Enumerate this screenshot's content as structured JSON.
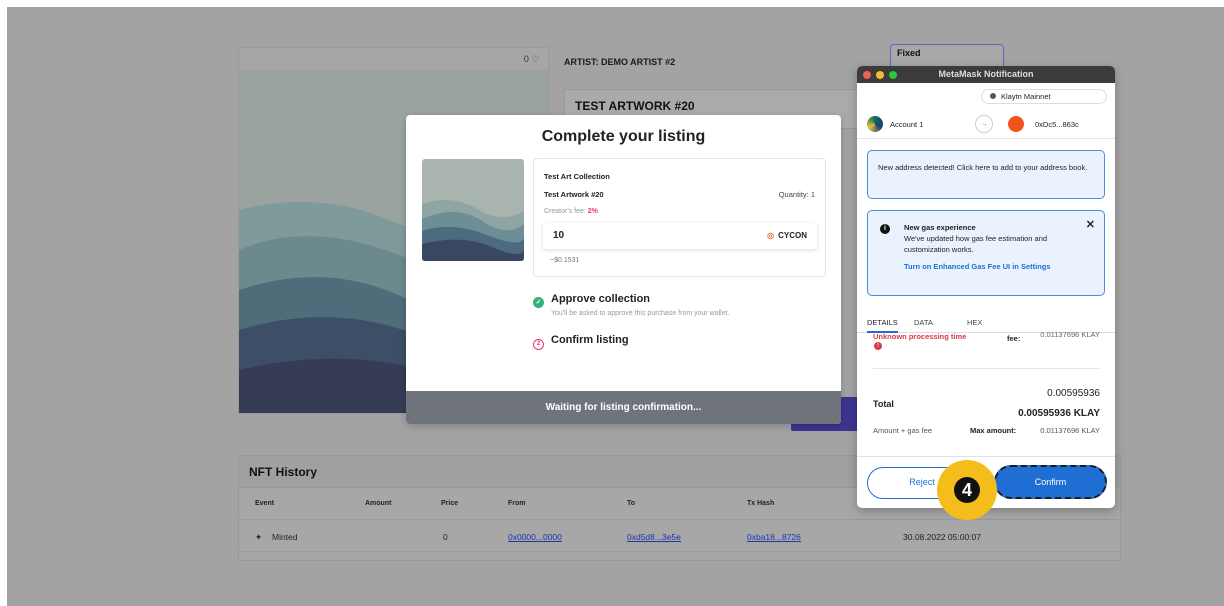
{
  "background": {
    "likes": "0",
    "artist_label": "ARTIST: DEMO ARTIST #2",
    "artwork_title": "TEST ARTWORK #20",
    "fixed_tab": "Fixed",
    "history": {
      "title": "NFT History",
      "columns": [
        "Event",
        "Amount",
        "Price",
        "From",
        "To",
        "Tx Hash"
      ],
      "row": {
        "event": "Minted",
        "price": "0",
        "from": "0x0000...0000",
        "to": "0xd5d8...3e5e",
        "tx": "0xba18...8726",
        "date": "30.08.2022 05:00:07"
      }
    }
  },
  "listing_modal": {
    "title": "Complete your listing",
    "collection": "Test Art Collection",
    "artwork": "Test Artwork #20",
    "quantity": "Quantity: 1",
    "creator_fee_label": "Creator's fee:",
    "creator_fee_value": "2%",
    "price_value": "10",
    "currency": "CYCON",
    "usd_value": "~$0.1531",
    "step1_title": "Approve collection",
    "step1_sub": "You'll be asked to approve this purchase from your wallet.",
    "step2_title": "Confirm listing",
    "footer": "Waiting for listing confirmation..."
  },
  "metamask": {
    "window_title": "MetaMask Notification",
    "network": "Klaytn Mainnet",
    "account_name": "Account 1",
    "to_address": "0xDc5...863c",
    "address_alert": "New address detected! Click here to add to your address book.",
    "gas_title": "New gas experience",
    "gas_body": "We've updated how gas fee estimation and customization works.",
    "gas_link": "Turn on Enhanced Gas Fee UI in Settings",
    "tabs": [
      "DETAILS",
      "DATA",
      "HEX"
    ],
    "processing_time": "Unknown processing time",
    "fee_label": "fee:",
    "fee_value": "0.01137696 KLAY",
    "total_label": "Total",
    "total_value": "0.00595936",
    "total_klay": "0.00595936 KLAY",
    "amount_gas_label": "Amount + gas fee",
    "max_label": "Max amount:",
    "max_value": "0.01137696 KLAY",
    "reject_label": "Reject",
    "confirm_label": "Confirm"
  },
  "step_badge": "4",
  "colors": {
    "metamask_blue": "#1f6ed4",
    "badge_yellow": "#f4bd1c",
    "approve_green": "#2fb37a",
    "fee_pink": "#e33c6a"
  }
}
